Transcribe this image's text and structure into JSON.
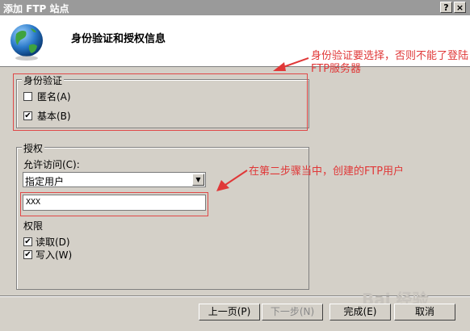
{
  "window": {
    "title": "添加 FTP 站点",
    "help_label": "?",
    "close_label": "×"
  },
  "header": {
    "title": "身份验证和授权信息"
  },
  "authentication": {
    "group_label": "身份验证",
    "anonymous_label": "匿名(A)",
    "anonymous_checked": false,
    "basic_label": "基本(B)",
    "basic_checked": true
  },
  "authorization": {
    "group_label": "授权",
    "allow_access_label": "允许访问(C):",
    "allow_access_value": "指定用户",
    "user_value": "XXX",
    "permissions_label": "权限",
    "read_label": "读取(D)",
    "read_checked": true,
    "write_label": "写入(W)",
    "write_checked": true
  },
  "annotations": {
    "auth_note": "身份验证要选择，否则不能了登陆FTP服务器",
    "user_note": "在第二步骤当中，创建的FTP用户"
  },
  "buttons": {
    "back": "上一页(P)",
    "next": "下一步(N)",
    "finish": "完成(E)",
    "cancel": "取消"
  },
  "watermark": "Bai 经验",
  "colors": {
    "annotation": "#e03838",
    "dialog_bg": "#d4d0c8"
  },
  "icons": [
    "globe-icon",
    "checkmark-icon",
    "dropdown-arrow-icon",
    "arrow-icon"
  ]
}
